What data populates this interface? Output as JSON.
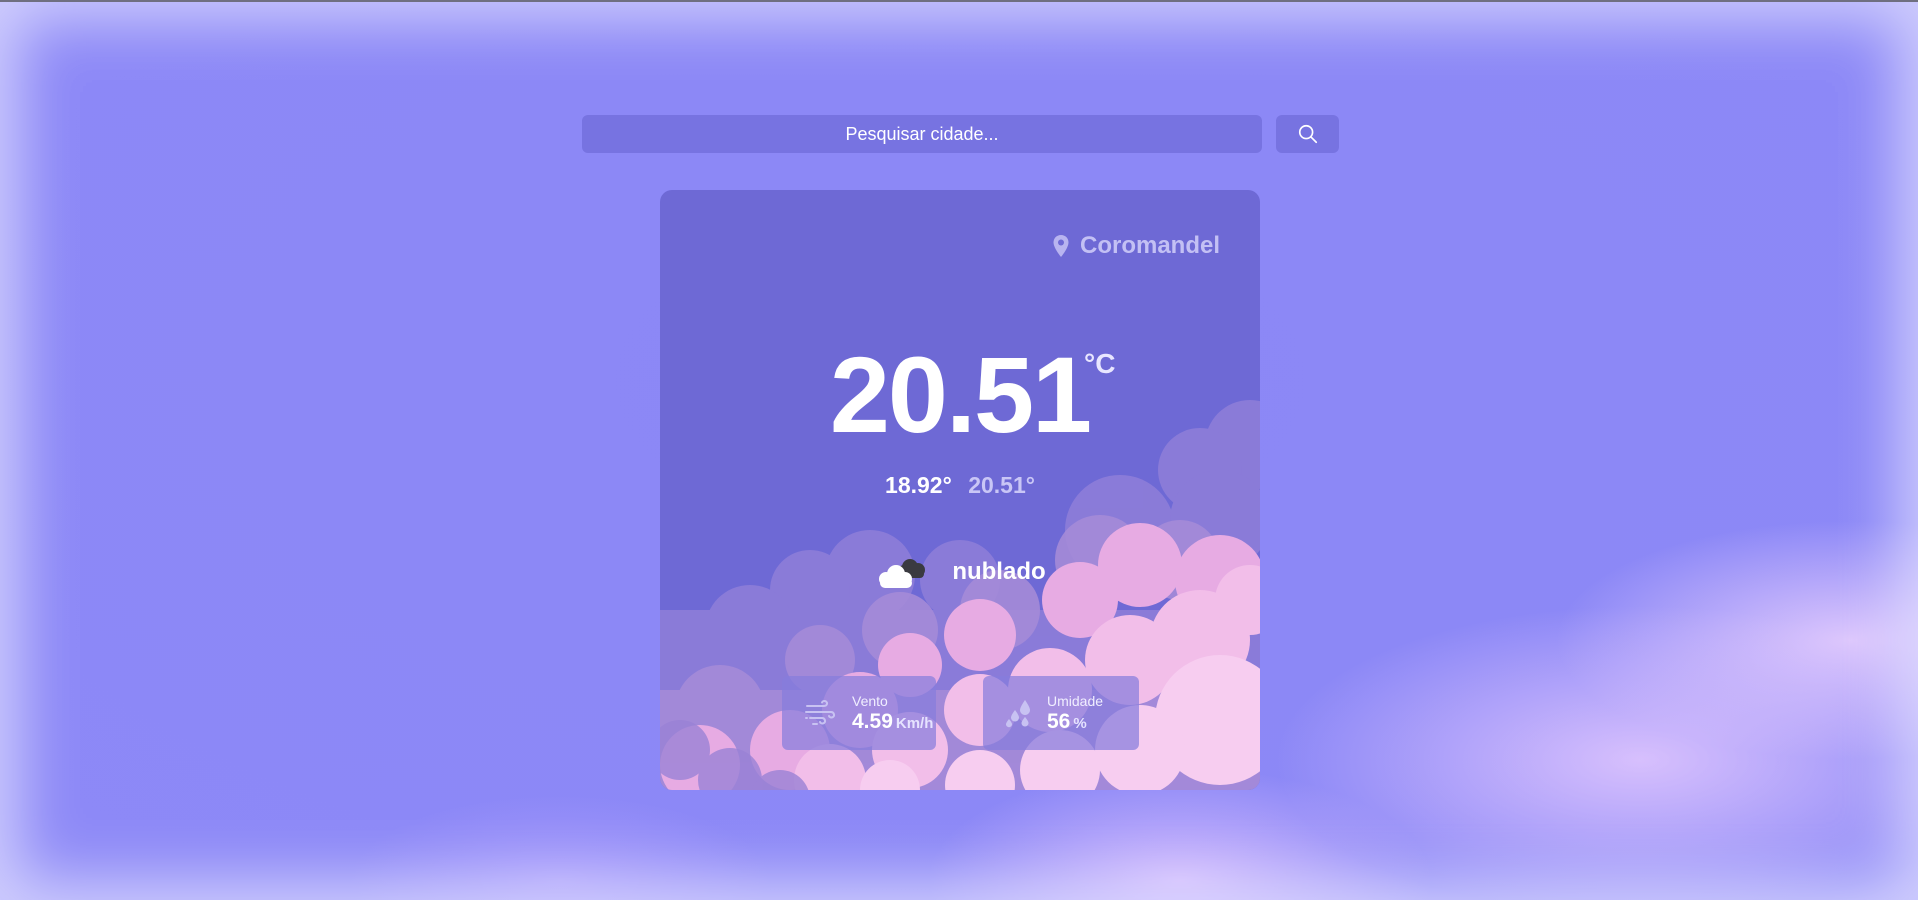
{
  "search": {
    "placeholder": "Pesquisar cidade...",
    "value": ""
  },
  "weather": {
    "city": "Coromandel",
    "temperature": "20.51",
    "unit": "°C",
    "temp_min": "18.92°",
    "temp_max": "20.51°",
    "condition": "nublado",
    "wind": {
      "label": "Vento",
      "value": "4.59",
      "unit": "Km/h"
    },
    "humidity": {
      "label": "Umidade",
      "value": "56",
      "unit": "%"
    }
  },
  "icons": {
    "search": "search-icon",
    "location": "map-pin-icon",
    "condition": "cloudy-icon",
    "wind": "wind-icon",
    "humidity": "humidity-icon"
  },
  "colors": {
    "page_background": "#8c88f7",
    "card_background": "#6e69d5",
    "search_background": "#7773e1",
    "cloud_pink": "#f3bde9",
    "text": "#ffffff"
  }
}
